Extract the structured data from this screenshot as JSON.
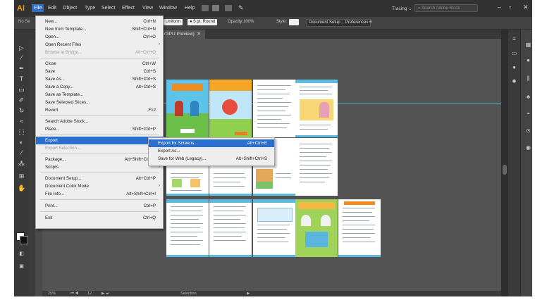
{
  "menubar": {
    "logo": "Ai",
    "items": [
      "File",
      "Edit",
      "Object",
      "Type",
      "Select",
      "Effect",
      "View",
      "Window",
      "Help"
    ],
    "tracking": "Tracing",
    "search_placeholder": "Search Adobe Stock"
  },
  "control_bar": {
    "nosel": "No Se",
    "stroke_style": "Uniform",
    "stroke_size": "5 pt. Round",
    "opacity_label": "Opacity:",
    "opacity_value": "100%",
    "style_label": "Style:",
    "doc_setup": "Document Setup",
    "preferences": "Preferences"
  },
  "doc_tab": {
    "title": "CMYK/GPU Preview)"
  },
  "file_menu": {
    "items": [
      {
        "label": "New...",
        "shortcut": "Ctrl+N"
      },
      {
        "label": "New from Template...",
        "shortcut": "Shift+Ctrl+N"
      },
      {
        "label": "Open...",
        "shortcut": "Ctrl+O"
      },
      {
        "label": "Open Recent Files",
        "shortcut": ""
      },
      {
        "label": "Browse in Bridge...",
        "shortcut": "Alt+Ctrl+O"
      },
      {
        "label": "Close",
        "shortcut": "Ctrl+W"
      },
      {
        "label": "Save",
        "shortcut": "Ctrl+S"
      },
      {
        "label": "Save As...",
        "shortcut": "Shift+Ctrl+S"
      },
      {
        "label": "Save a Copy...",
        "shortcut": "Alt+Ctrl+S"
      },
      {
        "label": "Save as Template...",
        "shortcut": ""
      },
      {
        "label": "Save Selected Slices...",
        "shortcut": ""
      },
      {
        "label": "Revert",
        "shortcut": "F12"
      },
      {
        "label": "Search Adobe Stock...",
        "shortcut": ""
      },
      {
        "label": "Place...",
        "shortcut": "Shift+Ctrl+P"
      },
      {
        "label": "Export",
        "shortcut": ""
      },
      {
        "label": "Export Selection...",
        "shortcut": ""
      },
      {
        "label": "Package...",
        "shortcut": "Alt+Shift+Ctrl+P"
      },
      {
        "label": "Scripts",
        "shortcut": ""
      },
      {
        "label": "Document Setup...",
        "shortcut": "Alt+Ctrl+P"
      },
      {
        "label": "Document Color Mode",
        "shortcut": ""
      },
      {
        "label": "File Info...",
        "shortcut": "Alt+Shift+Ctrl+I"
      },
      {
        "label": "Print...",
        "shortcut": "Ctrl+P"
      },
      {
        "label": "Exit",
        "shortcut": "Ctrl+Q"
      }
    ]
  },
  "export_submenu": {
    "items": [
      {
        "label": "Export for Screens...",
        "shortcut": "Alt+Ctrl+E"
      },
      {
        "label": "Export As...",
        "shortcut": ""
      },
      {
        "label": "Save for Web (Legacy)...",
        "shortcut": "Alt+Shift+Ctrl+S"
      }
    ]
  },
  "status_bar": {
    "zoom": "25%",
    "artboard": "12",
    "tool": "Selection"
  },
  "colors": {
    "highlight": "#2a6fce",
    "guide": "#46b6c9",
    "logo": "#ff9a00"
  }
}
